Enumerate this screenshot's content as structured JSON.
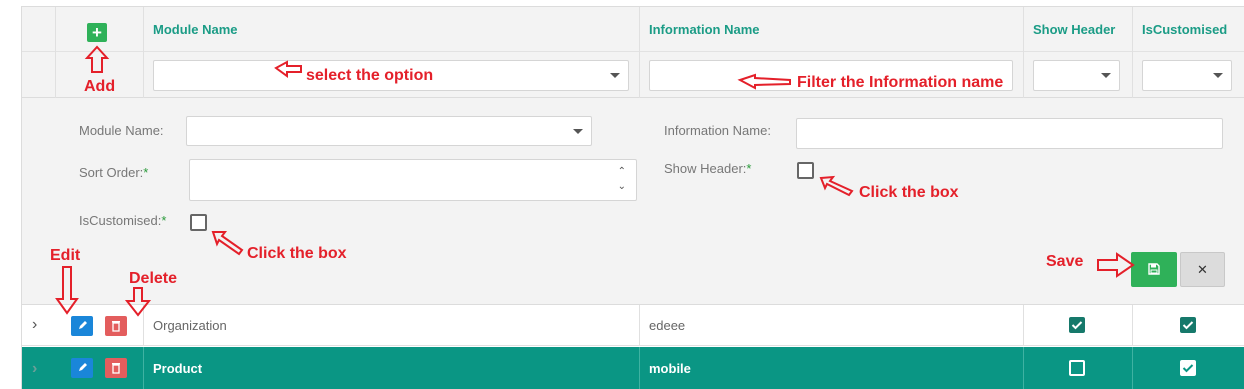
{
  "columns": {
    "module_name": "Module Name",
    "information_name": "Information Name",
    "show_header": "Show Header",
    "is_customised": "IsCustomised"
  },
  "add_icon": "plus-icon",
  "form": {
    "module_label": "Module Name:",
    "information_label": "Information Name:",
    "sort_order_label": "Sort Order:",
    "show_header_label": "Show Header:",
    "is_customised_label": "IsCustomised:",
    "required_mark": "*",
    "cancel_label": "✕",
    "save_icon": "floppy-disk-icon"
  },
  "rows": [
    {
      "module": "Organization",
      "information": "edeee",
      "show_header": true,
      "is_customised": true
    },
    {
      "module": "Product",
      "information": "mobile",
      "show_header": false,
      "is_customised": true
    }
  ],
  "annotations": {
    "add": "Add",
    "select_option": "select the option",
    "filter_info": "Filter the Information  name",
    "click_box_1": "Click the box",
    "click_box_2": "Click the box",
    "edit": "Edit",
    "delete": "Delete",
    "save": "Save"
  },
  "colors": {
    "accent": "#1b9c86",
    "selected_row": "#0a9684",
    "add_green": "#2fb159",
    "edit_blue": "#1a86d9",
    "delete_red": "#e35d5d",
    "annotation_red": "#e4202a"
  }
}
